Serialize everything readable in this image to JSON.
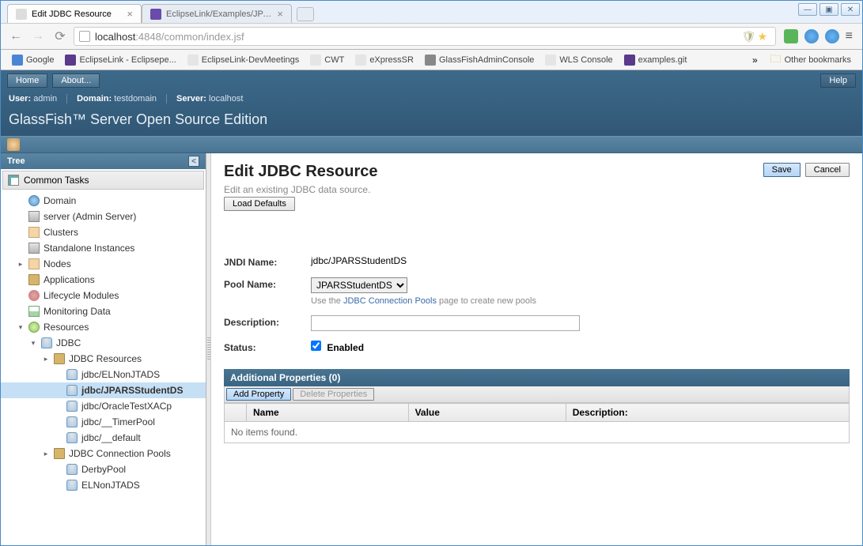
{
  "window": {
    "controls": {
      "min": "—",
      "max": "▣",
      "close": "✕"
    }
  },
  "tabs": [
    {
      "title": "Edit JDBC Resource",
      "active": true
    },
    {
      "title": "EclipseLink/Examples/JPARS",
      "active": false
    }
  ],
  "url": {
    "host": "localhost",
    "port": ":4848",
    "path": "/common/index.jsf"
  },
  "url_icons": {
    "shield": "🛡",
    "star": "★"
  },
  "bookmarks": [
    {
      "label": "Google",
      "color": "#4a85d5"
    },
    {
      "label": "EclipseLink - Eclipsepe...",
      "color": "#5a3a8a"
    },
    {
      "label": "EclipseLink-DevMeetings",
      "color": "#e5e5e5"
    },
    {
      "label": "CWT",
      "color": "#e5e5e5"
    },
    {
      "label": "eXpressSR",
      "color": "#e5e5e5"
    },
    {
      "label": "GlassFishAdminConsole",
      "color": "#888"
    },
    {
      "label": "WLS Console",
      "color": "#e5e5e5"
    },
    {
      "label": "examples.git",
      "color": "#5a3a8a"
    }
  ],
  "bookmarks_more": "»",
  "other_bookmarks": "Other bookmarks",
  "gf": {
    "home": "Home",
    "about": "About...",
    "help": "Help",
    "user_label": "User:",
    "user_val": "admin",
    "domain_label": "Domain:",
    "domain_val": "testdomain",
    "server_label": "Server:",
    "server_val": "localhost",
    "title": "GlassFish™ Server Open Source Edition"
  },
  "tree": {
    "header": "Tree",
    "common_tasks": "Common Tasks",
    "items": [
      {
        "label": "Domain",
        "icon": "ico-globe",
        "indent": 1,
        "exp": ""
      },
      {
        "label": "server (Admin Server)",
        "icon": "ico-server",
        "indent": 1,
        "exp": ""
      },
      {
        "label": "Clusters",
        "icon": "ico-cluster",
        "indent": 1,
        "exp": ""
      },
      {
        "label": "Standalone Instances",
        "icon": "ico-server",
        "indent": 1,
        "exp": ""
      },
      {
        "label": "Nodes",
        "icon": "ico-cluster",
        "indent": 1,
        "exp": "▸"
      },
      {
        "label": "Applications",
        "icon": "ico-folder",
        "indent": 1,
        "exp": ""
      },
      {
        "label": "Lifecycle Modules",
        "icon": "ico-gear",
        "indent": 1,
        "exp": ""
      },
      {
        "label": "Monitoring Data",
        "icon": "ico-chart",
        "indent": 1,
        "exp": ""
      },
      {
        "label": "Resources",
        "icon": "ico-res",
        "indent": 1,
        "exp": "▾"
      },
      {
        "label": "JDBC",
        "icon": "ico-db",
        "indent": 2,
        "exp": "▾"
      },
      {
        "label": "JDBC Resources",
        "icon": "ico-folder",
        "indent": 3,
        "exp": "▸"
      },
      {
        "label": "jdbc/ELNonJTADS",
        "icon": "ico-db",
        "indent": 4,
        "exp": ""
      },
      {
        "label": "jdbc/JPARSStudentDS",
        "icon": "ico-db",
        "indent": 4,
        "exp": "",
        "selected": true
      },
      {
        "label": "jdbc/OracleTestXACp",
        "icon": "ico-db",
        "indent": 4,
        "exp": ""
      },
      {
        "label": "jdbc/__TimerPool",
        "icon": "ico-db",
        "indent": 4,
        "exp": ""
      },
      {
        "label": "jdbc/__default",
        "icon": "ico-db",
        "indent": 4,
        "exp": ""
      },
      {
        "label": "JDBC Connection Pools",
        "icon": "ico-folder",
        "indent": 3,
        "exp": "▸"
      },
      {
        "label": "DerbyPool",
        "icon": "ico-db",
        "indent": 4,
        "exp": ""
      },
      {
        "label": "ELNonJTADS",
        "icon": "ico-db",
        "indent": 4,
        "exp": ""
      }
    ]
  },
  "main": {
    "title": "Edit JDBC Resource",
    "save": "Save",
    "cancel": "Cancel",
    "desc": "Edit an existing JDBC data source.",
    "load_defaults": "Load Defaults",
    "jndi_label": "JNDI Name:",
    "jndi_value": "jdbc/JPARSStudentDS",
    "pool_label": "Pool Name:",
    "pool_value": "JPARSStudentDS",
    "pool_hint_pre": "Use the ",
    "pool_hint_link": "JDBC Connection Pools",
    "pool_hint_post": " page to create new pools",
    "desc_field_label": "Description:",
    "desc_field_value": "",
    "status_label": "Status:",
    "status_value": "Enabled",
    "props_header": "Additional Properties (0)",
    "add_property": "Add Property",
    "delete_properties": "Delete Properties",
    "col_name": "Name",
    "col_value": "Value",
    "col_desc": "Description:",
    "no_items": "No items found."
  }
}
